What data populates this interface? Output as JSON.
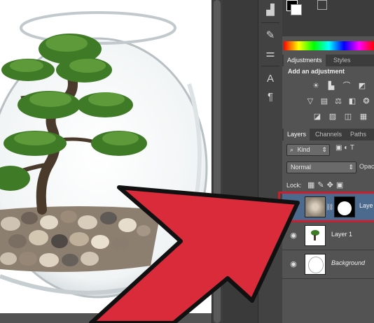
{
  "adjustments": {
    "tab_adjustments": "Adjustments",
    "tab_styles": "Styles",
    "heading": "Add an adjustment",
    "icons": [
      "brightness-icon",
      "levels-icon",
      "curves-icon",
      "exposure-icon",
      "vibrance-icon",
      "hue-icon",
      "color-balance-icon",
      "black-white-icon",
      "photo-filter-icon",
      "channel-mixer-icon",
      "invert-icon",
      "posterize-icon",
      "threshold-icon",
      "gradient-map-icon"
    ]
  },
  "layers": {
    "tab_layers": "Layers",
    "tab_channels": "Channels",
    "tab_paths": "Paths",
    "filter_label": "Kind",
    "blend_mode": "Normal",
    "opacity_label": "Opac",
    "lock_label": "Lock:",
    "rows": [
      {
        "name": "Laye",
        "selected": true
      },
      {
        "name": "Layer 1",
        "selected": false
      },
      {
        "name": "Background",
        "selected": false
      }
    ]
  },
  "colors": {
    "arrow": "#d92b3a",
    "highlight": "#c8202e",
    "selected_row": "#4b6a8e"
  }
}
